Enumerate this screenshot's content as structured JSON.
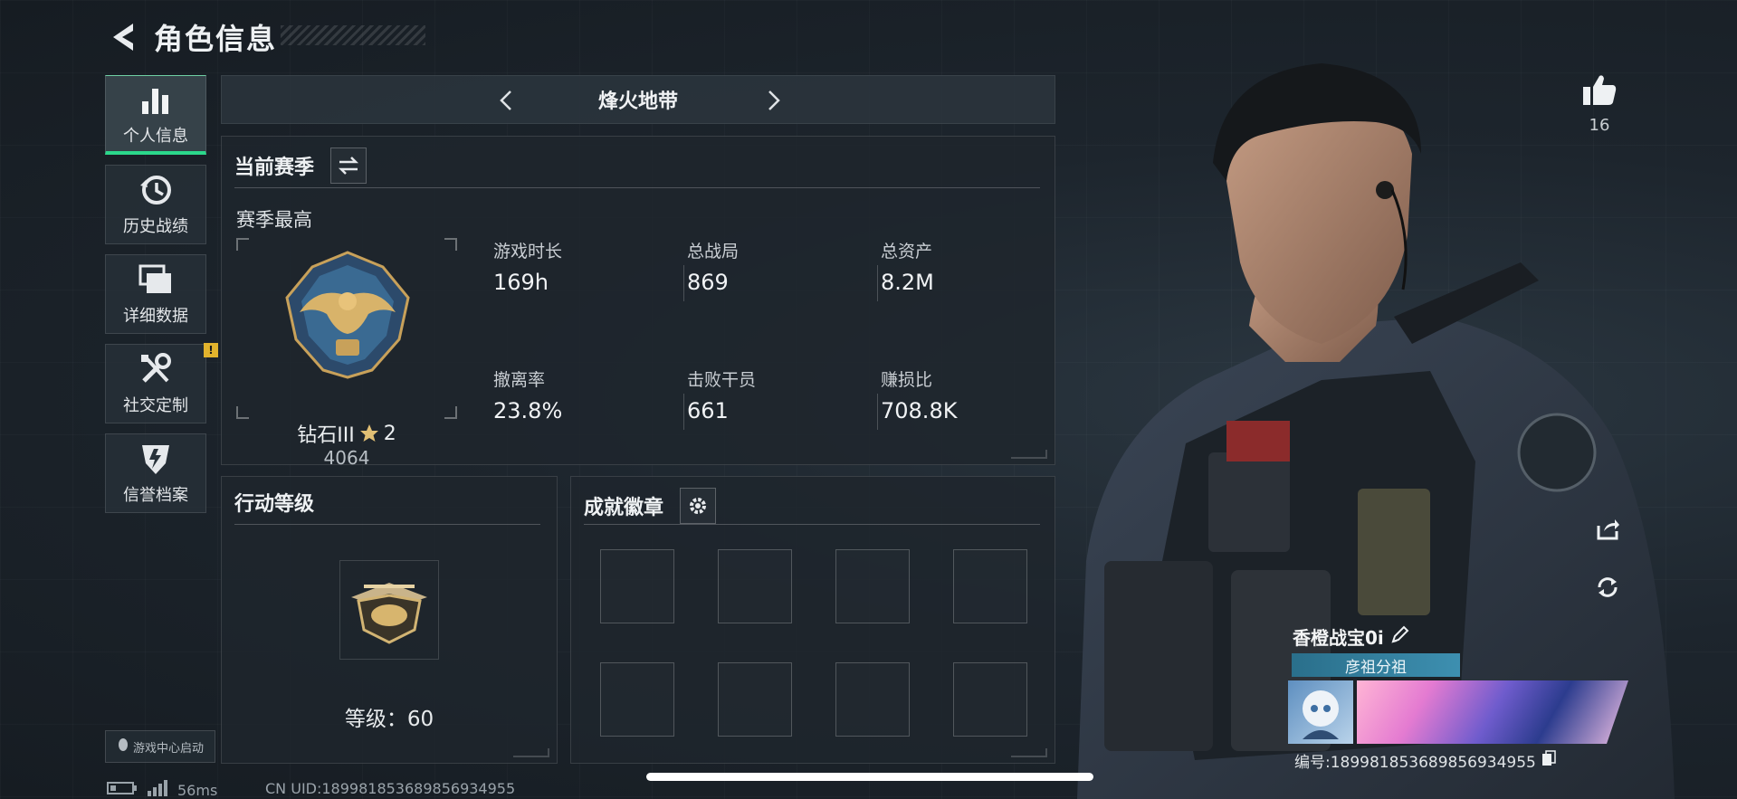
{
  "header": {
    "title": "角色信息"
  },
  "sidebar": {
    "items": [
      {
        "label": "个人信息",
        "icon": "bar-chart-icon",
        "active": true
      },
      {
        "label": "历史战绩",
        "icon": "history-clock-icon",
        "active": false
      },
      {
        "label": "详细数据",
        "icon": "stacked-cards-icon",
        "active": false
      },
      {
        "label": "社交定制",
        "icon": "tools-icon",
        "active": false,
        "badge": "!"
      },
      {
        "label": "信誉档案",
        "icon": "credit-shield-icon",
        "active": false
      }
    ],
    "game_center": "游戏中心启动"
  },
  "mode": {
    "title": "烽火地带"
  },
  "season": {
    "title": "当前赛季",
    "best_label": "赛季最高",
    "rank_name": "钻石III",
    "rank_stars": "2",
    "rank_points": "4064",
    "stats": [
      {
        "label": "游戏时长",
        "value": "169h"
      },
      {
        "label": "总战局",
        "value": "869"
      },
      {
        "label": "总资产",
        "value": "8.2M"
      },
      {
        "label": "撤离率",
        "value": "23.8%"
      },
      {
        "label": "击败干员",
        "value": "661"
      },
      {
        "label": "赚损比",
        "value": "708.8K"
      }
    ]
  },
  "action_level": {
    "title": "行动等级",
    "level_text": "等级：60"
  },
  "achievements": {
    "title": "成就徽章",
    "slots": 8
  },
  "profile": {
    "likes": "16",
    "player_name": "香橙战宝0i",
    "clan": "彦祖分祖",
    "id_label": "编号:1899818536898569349 55",
    "id_text": "编号:18998185368985693495 5"
  },
  "status": {
    "ping": "56ms",
    "uid": "CN UID:189981853689856934955"
  },
  "colors": {
    "accent": "#2bd88b",
    "badge": "#e2b32d",
    "clan": "#3d8fb0"
  }
}
